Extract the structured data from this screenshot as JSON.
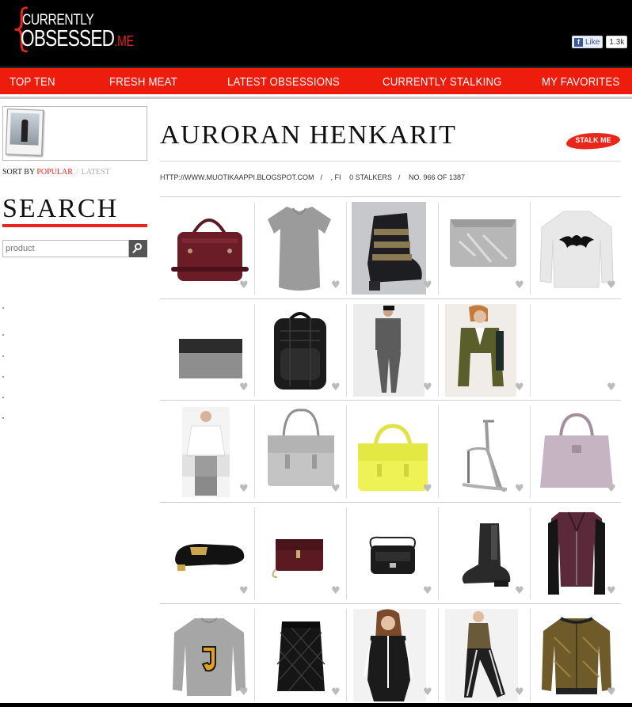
{
  "header": {
    "logo": {
      "line1": "CURRENTLY",
      "line2": "OBSESSED",
      "suffix": ".ME"
    },
    "facebook": {
      "like_label": "Like",
      "count": "1.3k"
    }
  },
  "nav": [
    {
      "label": "TOP TEN"
    },
    {
      "label": "FRESH MEAT"
    },
    {
      "label": "LATEST OBSESSIONS"
    },
    {
      "label": "CURRENTLY STALKING"
    },
    {
      "label": "MY FAVORITES"
    }
  ],
  "sidebar": {
    "sort": {
      "label": "SORT BY",
      "popular": "POPULAR",
      "separator": "/",
      "latest": "LATEST"
    },
    "search": {
      "title": "SEARCH",
      "placeholder": "product"
    }
  },
  "profile": {
    "title": "AURORAN HENKARIT",
    "stalk_button": "STALK ME",
    "url": "HTTP://WWW.MUOTIKAAPPI.BLOGSPOT.COM",
    "location": ", FI",
    "stalkers": "0 STALKERS",
    "rank": "NO. 966 OF 1387",
    "sep": "/"
  },
  "products": [
    [
      "burgundy-bag",
      "grey-tshirt",
      "studded-ankle-boot",
      "silver-clutch",
      "bat-print-sweater"
    ],
    [
      "grey-felt-clutch",
      "black-quilted-backpack",
      "grey-jumpsuit-model",
      "olive-blazer-model",
      "empty-item"
    ],
    [
      "white-tee-model",
      "grey-satchel",
      "yellow-satchel",
      "silver-heeled-sandal",
      "lilac-tote"
    ],
    [
      "velvet-slipper",
      "burgundy-crossbody",
      "black-camera-bag",
      "black-chelsea-boot",
      "burgundy-leather-jacket"
    ],
    [
      "j-letter-sweater",
      "quilted-leather-skirt",
      "adidas-track-jacket-model",
      "sequin-track-pants-model",
      "gold-bomber-jacket"
    ]
  ]
}
